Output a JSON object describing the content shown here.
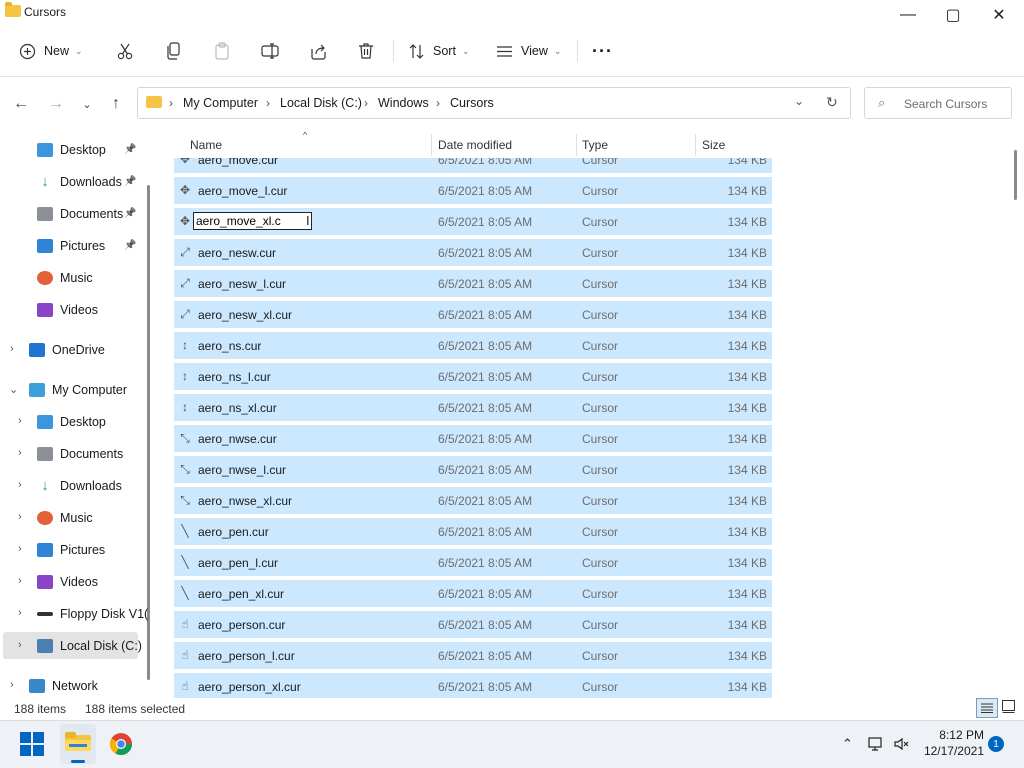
{
  "window": {
    "title": "Cursors",
    "minimize": "—",
    "maximize": "▢",
    "close": "✕"
  },
  "commandbar": {
    "new_label": "New",
    "sort_label": "Sort",
    "view_label": "View",
    "more_label": "···"
  },
  "navigation": {
    "breadcrumb": [
      "My Computer",
      "Local Disk (C:)",
      "Windows",
      "Cursors"
    ],
    "search_placeholder": "Search Cursors"
  },
  "sidebar": {
    "quick_access": [
      {
        "label": "Desktop",
        "icon": "desktop-icon",
        "color": "#3a96dd",
        "pinned": true
      },
      {
        "label": "Downloads",
        "icon": "download-icon",
        "color": "#2e9d5b",
        "pinned": true
      },
      {
        "label": "Documents",
        "icon": "documents-icon",
        "color": "#8a8f98",
        "pinned": true
      },
      {
        "label": "Pictures",
        "icon": "pictures-icon",
        "color": "#2f84d8",
        "pinned": true
      },
      {
        "label": "Music",
        "icon": "music-icon",
        "color": "#e0613a",
        "pinned": false
      },
      {
        "label": "Videos",
        "icon": "videos-icon",
        "color": "#8b44c9",
        "pinned": false
      }
    ],
    "onedrive": "OneDrive",
    "my_computer": "My Computer",
    "computer_children": [
      {
        "label": "Desktop",
        "icon": "desktop-icon",
        "color": "#3a96dd"
      },
      {
        "label": "Documents",
        "icon": "documents-icon",
        "color": "#8a8f98"
      },
      {
        "label": "Downloads",
        "icon": "download-icon",
        "color": "#2e9d5b"
      },
      {
        "label": "Music",
        "icon": "music-icon",
        "color": "#e0613a"
      },
      {
        "label": "Pictures",
        "icon": "pictures-icon",
        "color": "#2f84d8"
      },
      {
        "label": "Videos",
        "icon": "videos-icon",
        "color": "#8b44c9"
      },
      {
        "label": "Floppy Disk V1(",
        "icon": "floppy-icon",
        "color": "#333333"
      },
      {
        "label": "Local Disk (C:)",
        "icon": "disk-icon",
        "color": "#4b7fb3"
      }
    ],
    "network": "Network"
  },
  "columns": {
    "name": "Name",
    "date": "Date modified",
    "type": "Type",
    "size": "Size"
  },
  "files": [
    {
      "name": "aero_move.cur",
      "date": "6/5/2021 8:05 AM",
      "type": "Cursor",
      "size": "134 KB",
      "glyph": "✥"
    },
    {
      "name": "aero_move_l.cur",
      "date": "6/5/2021 8:05 AM",
      "type": "Cursor",
      "size": "134 KB",
      "glyph": "✥"
    },
    {
      "name": "aero_move_xl.c",
      "date": "6/5/2021 8:05 AM",
      "type": "Cursor",
      "size": "134 KB",
      "glyph": "✥",
      "renaming": true
    },
    {
      "name": "aero_nesw.cur",
      "date": "6/5/2021 8:05 AM",
      "type": "Cursor",
      "size": "134 KB",
      "glyph": "⤢"
    },
    {
      "name": "aero_nesw_l.cur",
      "date": "6/5/2021 8:05 AM",
      "type": "Cursor",
      "size": "134 KB",
      "glyph": "⤢"
    },
    {
      "name": "aero_nesw_xl.cur",
      "date": "6/5/2021 8:05 AM",
      "type": "Cursor",
      "size": "134 KB",
      "glyph": "⤢"
    },
    {
      "name": "aero_ns.cur",
      "date": "6/5/2021 8:05 AM",
      "type": "Cursor",
      "size": "134 KB",
      "glyph": "↕"
    },
    {
      "name": "aero_ns_l.cur",
      "date": "6/5/2021 8:05 AM",
      "type": "Cursor",
      "size": "134 KB",
      "glyph": "↕"
    },
    {
      "name": "aero_ns_xl.cur",
      "date": "6/5/2021 8:05 AM",
      "type": "Cursor",
      "size": "134 KB",
      "glyph": "↕"
    },
    {
      "name": "aero_nwse.cur",
      "date": "6/5/2021 8:05 AM",
      "type": "Cursor",
      "size": "134 KB",
      "glyph": "⤡"
    },
    {
      "name": "aero_nwse_l.cur",
      "date": "6/5/2021 8:05 AM",
      "type": "Cursor",
      "size": "134 KB",
      "glyph": "⤡"
    },
    {
      "name": "aero_nwse_xl.cur",
      "date": "6/5/2021 8:05 AM",
      "type": "Cursor",
      "size": "134 KB",
      "glyph": "⤡"
    },
    {
      "name": "aero_pen.cur",
      "date": "6/5/2021 8:05 AM",
      "type": "Cursor",
      "size": "134 KB",
      "glyph": "╲"
    },
    {
      "name": "aero_pen_l.cur",
      "date": "6/5/2021 8:05 AM",
      "type": "Cursor",
      "size": "134 KB",
      "glyph": "╲"
    },
    {
      "name": "aero_pen_xl.cur",
      "date": "6/5/2021 8:05 AM",
      "type": "Cursor",
      "size": "134 KB",
      "glyph": "╲"
    },
    {
      "name": "aero_person.cur",
      "date": "6/5/2021 8:05 AM",
      "type": "Cursor",
      "size": "134 KB",
      "glyph": "☝"
    },
    {
      "name": "aero_person_l.cur",
      "date": "6/5/2021 8:05 AM",
      "type": "Cursor",
      "size": "134 KB",
      "glyph": "☝"
    },
    {
      "name": "aero_person_xl.cur",
      "date": "6/5/2021 8:05 AM",
      "type": "Cursor",
      "size": "134 KB",
      "glyph": "☝"
    }
  ],
  "status": {
    "items": "188 items",
    "selected": "188 items selected"
  },
  "taskbar": {
    "time": "8:12 PM",
    "date": "12/17/2021",
    "notification_count": "1"
  },
  "colors": {
    "selection": "#cce8ff",
    "accent": "#0067c0"
  }
}
